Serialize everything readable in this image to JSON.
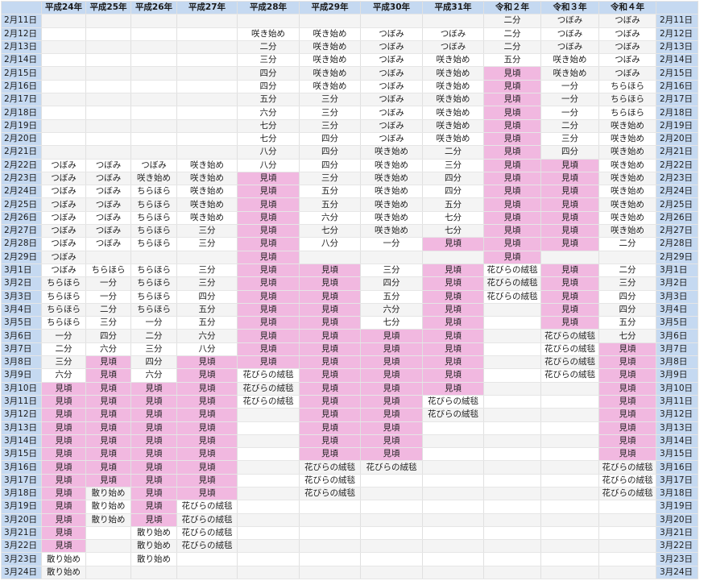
{
  "years": [
    "平成24年",
    "平成25年",
    "平成26年",
    "平成27年",
    "平成28年",
    "平成29年",
    "平成30年",
    "平成31年",
    "令和２年",
    "令和３年",
    "令和４年"
  ],
  "peak_label": "見頃",
  "colors": {
    "header": "#c5d9f1",
    "peak": "#f1b8e0",
    "stripe": "#f4f4f4"
  },
  "rows": [
    {
      "date": "2月11日",
      "values": [
        "",
        "",
        "",
        "",
        "",
        "",
        "",
        "",
        "二分",
        "つぼみ",
        "つぼみ"
      ]
    },
    {
      "date": "2月12日",
      "values": [
        "",
        "",
        "",
        "",
        "咲き始め",
        "咲き始め",
        "つぼみ",
        "つぼみ",
        "二分",
        "つぼみ",
        "つぼみ"
      ]
    },
    {
      "date": "2月13日",
      "values": [
        "",
        "",
        "",
        "",
        "二分",
        "咲き始め",
        "つぼみ",
        "つぼみ",
        "二分",
        "つぼみ",
        "つぼみ"
      ]
    },
    {
      "date": "2月14日",
      "values": [
        "",
        "",
        "",
        "",
        "三分",
        "咲き始め",
        "つぼみ",
        "咲き始め",
        "五分",
        "咲き始め",
        "つぼみ"
      ]
    },
    {
      "date": "2月15日",
      "values": [
        "",
        "",
        "",
        "",
        "四分",
        "咲き始め",
        "つぼみ",
        "咲き始め",
        "見頃",
        "咲き始め",
        "つぼみ"
      ]
    },
    {
      "date": "2月16日",
      "values": [
        "",
        "",
        "",
        "",
        "四分",
        "咲き始め",
        "つぼみ",
        "咲き始め",
        "見頃",
        "一分",
        "ちらほら"
      ]
    },
    {
      "date": "2月17日",
      "values": [
        "",
        "",
        "",
        "",
        "五分",
        "三分",
        "つぼみ",
        "咲き始め",
        "見頃",
        "一分",
        "ちらほら"
      ]
    },
    {
      "date": "2月18日",
      "values": [
        "",
        "",
        "",
        "",
        "六分",
        "三分",
        "つぼみ",
        "咲き始め",
        "見頃",
        "一分",
        "ちらほら"
      ]
    },
    {
      "date": "2月19日",
      "values": [
        "",
        "",
        "",
        "",
        "七分",
        "三分",
        "つぼみ",
        "咲き始め",
        "見頃",
        "二分",
        "咲き始め"
      ]
    },
    {
      "date": "2月20日",
      "values": [
        "",
        "",
        "",
        "",
        "七分",
        "四分",
        "つぼみ",
        "咲き始め",
        "見頃",
        "三分",
        "咲き始め"
      ]
    },
    {
      "date": "2月21日",
      "values": [
        "",
        "",
        "",
        "",
        "八分",
        "四分",
        "咲き始め",
        "二分",
        "見頃",
        "四分",
        "咲き始め"
      ]
    },
    {
      "date": "2月22日",
      "values": [
        "つぼみ",
        "つぼみ",
        "つぼみ",
        "咲き始め",
        "八分",
        "四分",
        "咲き始め",
        "三分",
        "見頃",
        "見頃",
        "咲き始め"
      ]
    },
    {
      "date": "2月23日",
      "values": [
        "つぼみ",
        "つぼみ",
        "咲き始め",
        "咲き始め",
        "見頃",
        "三分",
        "咲き始め",
        "四分",
        "見頃",
        "見頃",
        "咲き始め"
      ]
    },
    {
      "date": "2月24日",
      "values": [
        "つぼみ",
        "つぼみ",
        "ちらほら",
        "咲き始め",
        "見頃",
        "五分",
        "咲き始め",
        "四分",
        "見頃",
        "見頃",
        "咲き始め"
      ]
    },
    {
      "date": "2月25日",
      "values": [
        "つぼみ",
        "つぼみ",
        "ちらほら",
        "咲き始め",
        "見頃",
        "五分",
        "咲き始め",
        "五分",
        "見頃",
        "見頃",
        "咲き始め"
      ]
    },
    {
      "date": "2月26日",
      "values": [
        "つぼみ",
        "つぼみ",
        "ちらほら",
        "咲き始め",
        "見頃",
        "六分",
        "咲き始め",
        "七分",
        "見頃",
        "見頃",
        "咲き始め"
      ]
    },
    {
      "date": "2月27日",
      "values": [
        "つぼみ",
        "つぼみ",
        "ちらほら",
        "三分",
        "見頃",
        "七分",
        "咲き始め",
        "七分",
        "見頃",
        "見頃",
        "咲き始め"
      ]
    },
    {
      "date": "2月28日",
      "values": [
        "つぼみ",
        "つぼみ",
        "ちらほら",
        "三分",
        "見頃",
        "八分",
        "一分",
        "見頃",
        "見頃",
        "見頃",
        "二分"
      ]
    },
    {
      "date": "2月29日",
      "values": [
        "つぼみ",
        "",
        "",
        "",
        "見頃",
        "",
        "",
        "",
        "見頃",
        "",
        ""
      ]
    },
    {
      "date": "3月1日",
      "values": [
        "つぼみ",
        "ちらほら",
        "ちらほら",
        "三分",
        "見頃",
        "見頃",
        "三分",
        "見頃",
        "花びらの絨毯",
        "見頃",
        "二分"
      ]
    },
    {
      "date": "3月2日",
      "values": [
        "ちらほら",
        "一分",
        "ちらほら",
        "三分",
        "見頃",
        "見頃",
        "四分",
        "見頃",
        "花びらの絨毯",
        "見頃",
        "三分"
      ]
    },
    {
      "date": "3月3日",
      "values": [
        "ちらほら",
        "一分",
        "ちらほら",
        "四分",
        "見頃",
        "見頃",
        "五分",
        "見頃",
        "花びらの絨毯",
        "見頃",
        "四分"
      ]
    },
    {
      "date": "3月4日",
      "values": [
        "ちらほら",
        "二分",
        "ちらほら",
        "五分",
        "見頃",
        "見頃",
        "六分",
        "見頃",
        "",
        "見頃",
        "四分"
      ]
    },
    {
      "date": "3月5日",
      "values": [
        "ちらほら",
        "三分",
        "一分",
        "五分",
        "見頃",
        "見頃",
        "七分",
        "見頃",
        "",
        "見頃",
        "五分"
      ]
    },
    {
      "date": "3月6日",
      "values": [
        "一分",
        "四分",
        "二分",
        "六分",
        "見頃",
        "見頃",
        "見頃",
        "見頃",
        "",
        "花びらの絨毯",
        "七分"
      ]
    },
    {
      "date": "3月7日",
      "values": [
        "二分",
        "六分",
        "三分",
        "八分",
        "見頃",
        "見頃",
        "見頃",
        "見頃",
        "",
        "花びらの絨毯",
        "見頃"
      ]
    },
    {
      "date": "3月8日",
      "values": [
        "三分",
        "見頃",
        "四分",
        "見頃",
        "見頃",
        "見頃",
        "見頃",
        "見頃",
        "",
        "花びらの絨毯",
        "見頃"
      ]
    },
    {
      "date": "3月9日",
      "values": [
        "六分",
        "見頃",
        "六分",
        "見頃",
        "花びらの絨毯",
        "見頃",
        "見頃",
        "見頃",
        "",
        "花びらの絨毯",
        "見頃"
      ]
    },
    {
      "date": "3月10日",
      "values": [
        "見頃",
        "見頃",
        "見頃",
        "見頃",
        "花びらの絨毯",
        "見頃",
        "見頃",
        "見頃",
        "",
        "",
        "見頃"
      ]
    },
    {
      "date": "3月11日",
      "values": [
        "見頃",
        "見頃",
        "見頃",
        "見頃",
        "花びらの絨毯",
        "見頃",
        "見頃",
        "花びらの絨毯",
        "",
        "",
        "見頃"
      ]
    },
    {
      "date": "3月12日",
      "values": [
        "見頃",
        "見頃",
        "見頃",
        "見頃",
        "",
        "見頃",
        "見頃",
        "花びらの絨毯",
        "",
        "",
        "見頃"
      ]
    },
    {
      "date": "3月13日",
      "values": [
        "見頃",
        "見頃",
        "見頃",
        "見頃",
        "",
        "見頃",
        "見頃",
        "",
        "",
        "",
        "見頃"
      ]
    },
    {
      "date": "3月14日",
      "values": [
        "見頃",
        "見頃",
        "見頃",
        "見頃",
        "",
        "見頃",
        "見頃",
        "",
        "",
        "",
        "見頃"
      ]
    },
    {
      "date": "3月15日",
      "values": [
        "見頃",
        "見頃",
        "見頃",
        "見頃",
        "",
        "見頃",
        "見頃",
        "",
        "",
        "",
        "見頃"
      ]
    },
    {
      "date": "3月16日",
      "values": [
        "見頃",
        "見頃",
        "見頃",
        "見頃",
        "",
        "花びらの絨毯",
        "花びらの絨毯",
        "",
        "",
        "",
        "花びらの絨毯"
      ]
    },
    {
      "date": "3月17日",
      "values": [
        "見頃",
        "見頃",
        "見頃",
        "見頃",
        "",
        "花びらの絨毯",
        "",
        "",
        "",
        "",
        "花びらの絨毯"
      ]
    },
    {
      "date": "3月18日",
      "values": [
        "見頃",
        "散り始め",
        "見頃",
        "見頃",
        "",
        "花びらの絨毯",
        "",
        "",
        "",
        "",
        "花びらの絨毯"
      ]
    },
    {
      "date": "3月19日",
      "values": [
        "見頃",
        "散り始め",
        "見頃",
        "花びらの絨毯",
        "",
        "",
        "",
        "",
        "",
        "",
        ""
      ]
    },
    {
      "date": "3月20日",
      "values": [
        "見頃",
        "散り始め",
        "見頃",
        "花びらの絨毯",
        "",
        "",
        "",
        "",
        "",
        "",
        ""
      ]
    },
    {
      "date": "3月21日",
      "values": [
        "見頃",
        "",
        "散り始め",
        "花びらの絨毯",
        "",
        "",
        "",
        "",
        "",
        "",
        ""
      ]
    },
    {
      "date": "3月22日",
      "values": [
        "見頃",
        "",
        "散り始め",
        "花びらの絨毯",
        "",
        "",
        "",
        "",
        "",
        "",
        ""
      ]
    },
    {
      "date": "3月23日",
      "values": [
        "散り始め",
        "",
        "散り始め",
        "",
        "",
        "",
        "",
        "",
        "",
        "",
        ""
      ]
    },
    {
      "date": "3月24日",
      "values": [
        "散り始め",
        "",
        "",
        "",
        "",
        "",
        "",
        "",
        "",
        "",
        ""
      ]
    }
  ]
}
